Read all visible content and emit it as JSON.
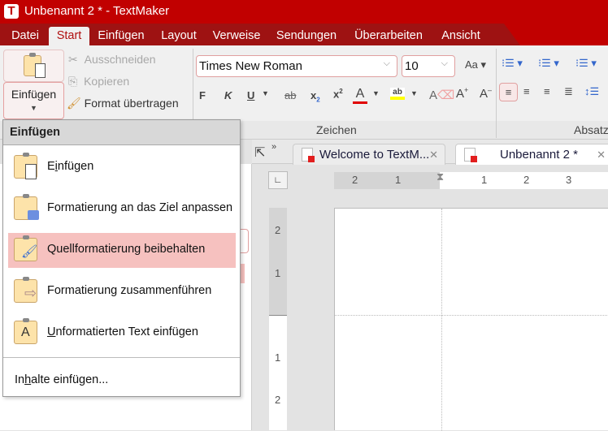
{
  "window": {
    "title": "Unbenannt 2 * - TextMaker",
    "logo": "T"
  },
  "menubar": {
    "tabs": [
      "Datei",
      "Start",
      "Einfügen",
      "Layout",
      "Verweise",
      "Sendungen",
      "Überarbeiten",
      "Ansicht"
    ],
    "active": "Start"
  },
  "ribbon": {
    "paste_label": "Einfügen",
    "cut": "Ausschneiden",
    "copy": "Kopieren",
    "format_painter": "Format übertragen",
    "font_name": "Times New Roman",
    "font_size": "10",
    "format_buttons": [
      "F",
      "K",
      "U"
    ],
    "groups": {
      "zeichen": "Zeichen",
      "absatz": "Absatz"
    },
    "font_color": "#e00000",
    "highlight_color": "#ffff00"
  },
  "doc_tabs": [
    {
      "label": "Welcome to TextM...",
      "active": false
    },
    {
      "label": "Unbenannt 2 *",
      "active": true
    }
  ],
  "rulers": {
    "horizontal": [
      "2",
      "1",
      "1",
      "2",
      "3"
    ],
    "vertical": [
      "2",
      "1",
      "1",
      "2"
    ]
  },
  "paste_menu": {
    "header": "Einfügen",
    "items": [
      {
        "pre": "E",
        "ul": "i",
        "post": "nfügen",
        "icon": "paste-document-icon"
      },
      {
        "pre": "Formatierung an das Ziel anpassen",
        "ul": "",
        "post": "",
        "icon": "paste-puzzle-icon"
      },
      {
        "pre": "Quellformatierung beibehalten",
        "ul": "",
        "post": "",
        "icon": "paste-brush-icon",
        "highlighted": true
      },
      {
        "pre": "Formatierung zusammenführen",
        "ul": "",
        "post": "",
        "icon": "paste-arrow-icon"
      },
      {
        "pre": "",
        "ul": "U",
        "post": "nformatierten Text einfügen",
        "icon": "paste-text-icon"
      }
    ],
    "special": {
      "pre": "In",
      "ul": "h",
      "post": "alte einfügen..."
    }
  }
}
